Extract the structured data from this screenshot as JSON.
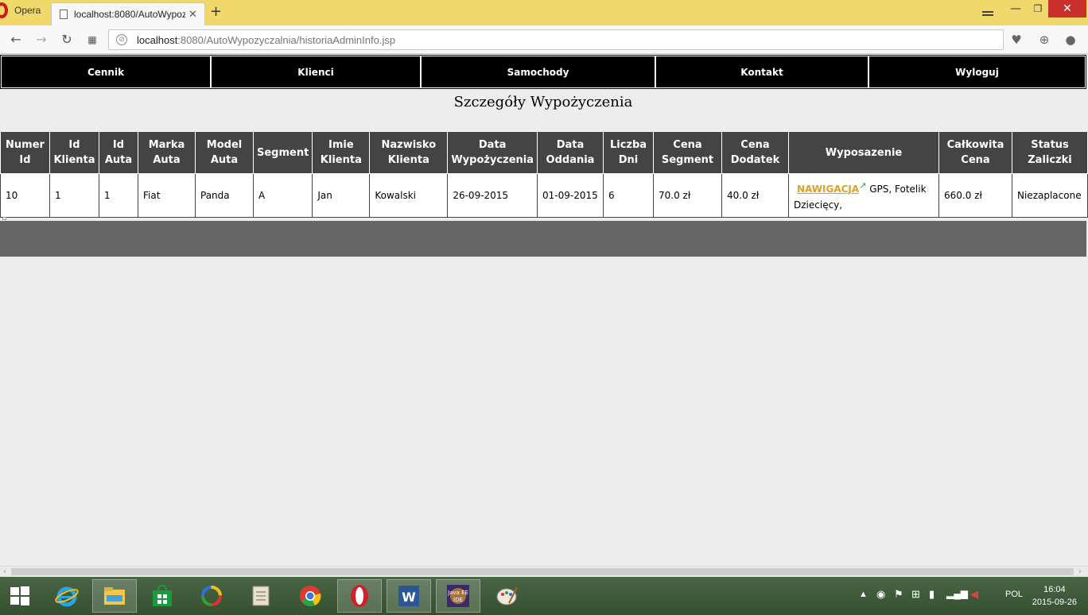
{
  "browser": {
    "opera_label": "Opera",
    "tab_title": "localhost:8080/AutoWypoz",
    "tab_close": "✕",
    "new_tab": "+",
    "url_host": "localhost",
    "url_rest": ":8080/AutoWypozyczalnia/historiaAdminInfo.jsp",
    "window_min": "—",
    "window_max": "❐",
    "window_close": "✕"
  },
  "nav": {
    "items": [
      "Cennik",
      "Klienci",
      "Samochody",
      "Kontakt",
      "Wyloguj"
    ]
  },
  "page": {
    "title": "Szczegóły Wypożyczenia"
  },
  "table": {
    "headers": [
      "Numer Id",
      "Id Klienta",
      "Id Auta",
      "Marka Auta",
      "Model Auta",
      "Segment",
      "Imie Klienta",
      "Nazwisko Klienta",
      "Data Wypożyczenia",
      "Data Oddania",
      "Liczba Dni",
      "Cena Segment",
      "Cena Dodatek",
      "Wyposazenie",
      "Całkowita Cena",
      "Status Zaliczki"
    ],
    "row": {
      "numer_id": "10",
      "id_klienta": "1",
      "id_auta": "1",
      "marka": "Fiat",
      "model": "Panda",
      "segment": "A",
      "imie": "Jan",
      "nazwisko": "Kowalski",
      "data_wyp": "26-09-2015",
      "data_odd": "01-09-2015",
      "liczba_dni": "6",
      "cena_segment": "70.0 zł",
      "cena_dodatek": "40.0 zł",
      "wyposazenie_link": "NAWIGACJA",
      "wyposazenie_rest": " GPS, Fotelik Dziecięcy,",
      "calkowita": "660.0 zł",
      "status": "Niezaplacone"
    }
  },
  "taskbar": {
    "lang": "POL",
    "time": "16:04",
    "date": "2015-09-26"
  },
  "colors": {
    "titlebar": "#f0d86a",
    "header_bg": "#444444",
    "nav_bg": "#000000",
    "link": "#e0a020",
    "footer_band": "#666666"
  }
}
